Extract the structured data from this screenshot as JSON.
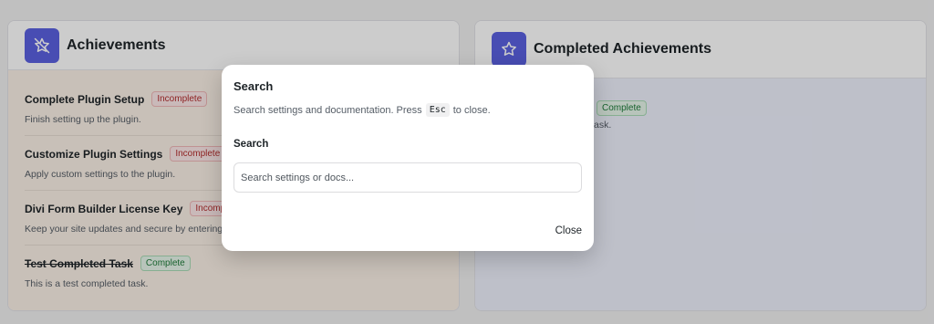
{
  "left_card": {
    "title": "Achievements",
    "icon": "star-off-icon",
    "tasks": [
      {
        "title": "Complete Plugin Setup",
        "status": "Incomplete",
        "description": "Finish setting up the plugin."
      },
      {
        "title": "Customize Plugin Settings",
        "status": "Incomplete",
        "description": "Apply custom settings to the plugin."
      },
      {
        "title": "Divi Form Builder License Key",
        "status": "Incomplete",
        "description": "Keep your site updates and secure by entering y"
      },
      {
        "title": "Test Completed Task",
        "status": "Complete",
        "description": "This is a test completed task."
      }
    ]
  },
  "right_card": {
    "title": "Completed Achievements",
    "icon": "star-icon",
    "visible_badge": "Complete",
    "visible_desc_fragment": "ask."
  },
  "modal": {
    "title": "Search",
    "description_prefix": "Search settings and documentation. Press",
    "kbd": "Esc",
    "description_suffix": "to close.",
    "field_label": "Search",
    "input_placeholder": "Search settings or docs...",
    "input_value": "",
    "close_label": "Close"
  },
  "colors": {
    "accent": "#5b61e0",
    "left_body_bg": "#fbf0e6",
    "right_body_bg": "#eef0fc"
  }
}
